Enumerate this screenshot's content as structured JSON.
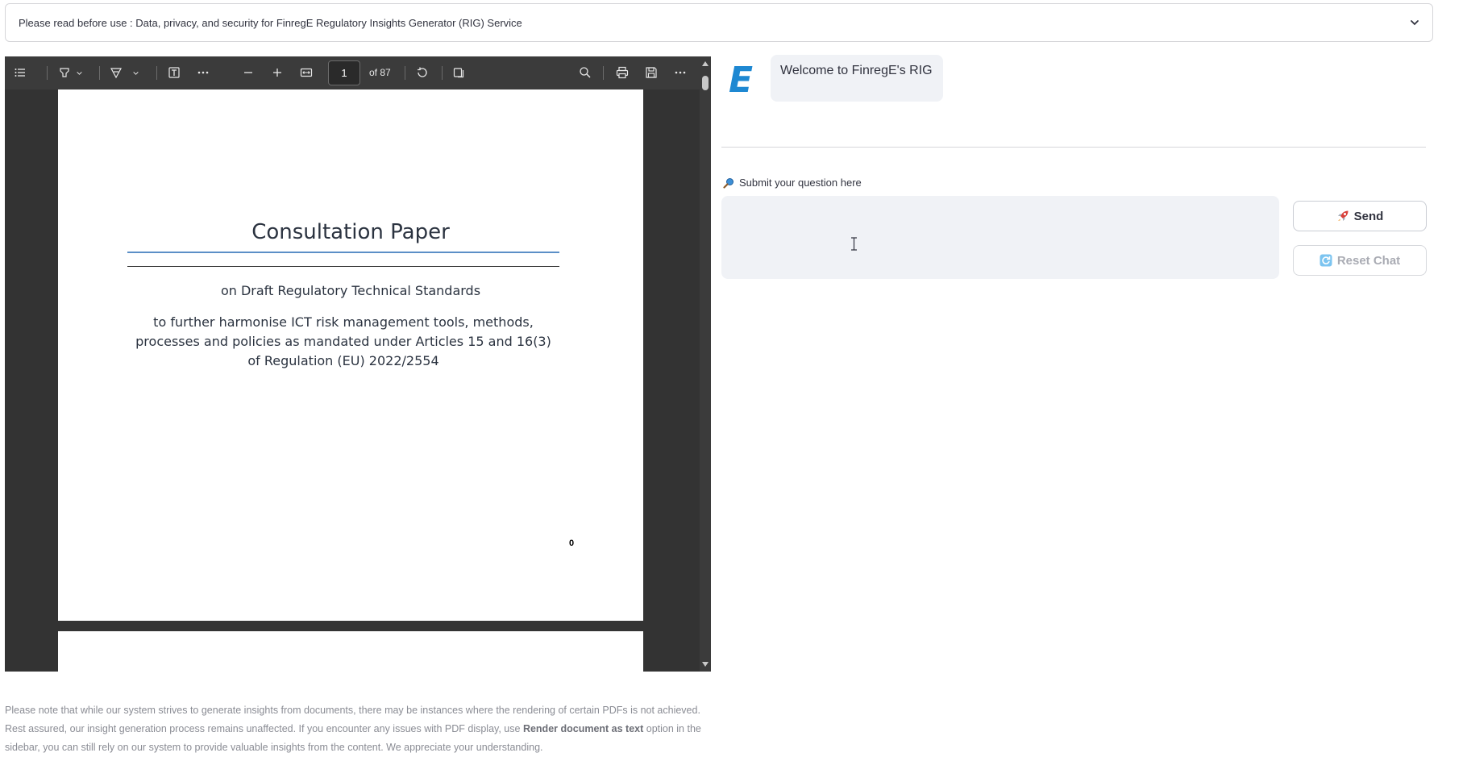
{
  "expander": {
    "label": "Please read before use : Data, privacy, and security for FinregE Regulatory Insights Generator (RIG) Service",
    "icon": "chevron-down-icon"
  },
  "pdf_viewer": {
    "toolbar": {
      "icons": [
        "outline-icon",
        "highlight-icon",
        "draw-icon",
        "text-icon",
        "more-tools-icon",
        "zoom-out-icon",
        "zoom-in-icon",
        "fit-page-icon",
        "rotate-icon",
        "two-page-icon",
        "search-icon",
        "print-icon",
        "save-icon",
        "more-options-icon"
      ],
      "current_page": "1",
      "page_count_label": "of 87"
    },
    "page": {
      "title": "Consultation Paper",
      "subtitle": "on Draft Regulatory Technical Standards",
      "body": "to further harmonise ICT risk management tools, methods, processes and policies as mandated under Articles 15 and 16(3) of Regulation (EU) 2022/2554",
      "page_number": "0"
    }
  },
  "notice": {
    "part1": "Please note that while our system strives to generate insights from documents, there may be instances where the rendering of certain PDFs is not achieved. Rest assured, our insight generation process remains unaffected. If you encounter any issues with PDF display, use ",
    "bold": "Render document as text",
    "part2": " option in the sidebar, you can still rely on our system to provide valuable insights from the content. We appreciate your understanding."
  },
  "chat": {
    "logo_letter": "E",
    "welcome": "Welcome to FinregE's RIG",
    "question_label": "Submit your question here",
    "question_value": "",
    "send_label": "Send",
    "reset_label": "Reset Chat",
    "colors": {
      "logo": "#1e88d2",
      "bubble": "#f0f2f6",
      "input_bg": "#f0f2f6"
    }
  }
}
